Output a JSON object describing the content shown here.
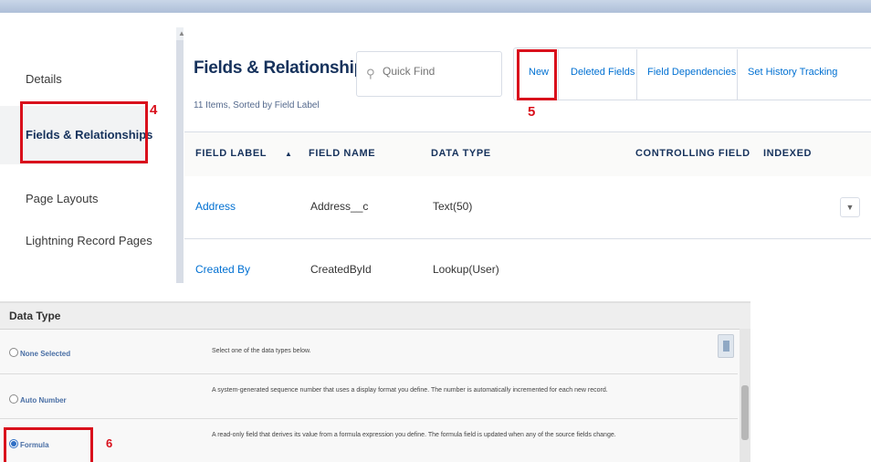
{
  "sidebar": {
    "items": [
      {
        "label": "Details"
      },
      {
        "label": "Fields & Relationships"
      },
      {
        "label": "Page Layouts"
      },
      {
        "label": "Lightning Record Pages"
      }
    ]
  },
  "fields_panel": {
    "title": "Fields & Relationships",
    "subtitle": "11 Items, Sorted by Field Label",
    "search_placeholder": "Quick Find",
    "toolbar": {
      "new_label": "New",
      "deleted_fields_label": "Deleted Fields",
      "field_dependencies_label": "Field Dependencies",
      "set_history_label": "Set History Tracking"
    },
    "columns": {
      "field_label": "FIELD LABEL",
      "sort_icon": "▲",
      "field_name": "FIELD NAME",
      "data_type": "DATA TYPE",
      "controlling_field": "CONTROLLING FIELD",
      "indexed": "INDEXED"
    },
    "rows": [
      {
        "field_label": "Address",
        "field_name": "Address__c",
        "data_type": "Text(50)",
        "menu": "▼"
      },
      {
        "field_label": "Created By",
        "field_name": "CreatedById",
        "data_type": "Lookup(User)"
      }
    ]
  },
  "annotations": {
    "step4": "4",
    "step5": "5",
    "step6": "6"
  },
  "data_type_panel": {
    "header": "Data Type",
    "options": [
      {
        "label": "None Selected",
        "description": "Select one of the data types below."
      },
      {
        "label": "Auto Number",
        "description": "A system-generated sequence number that uses a display format you define. The number is automatically incremented for each new record."
      },
      {
        "label": "Formula",
        "description": "A read-only field that derives its value from a formula expression you define. The formula field is updated when any of the source fields change."
      }
    ]
  },
  "colors": {
    "highlight": "#d9101c",
    "link": "#0070d2",
    "heading": "#16325c"
  }
}
